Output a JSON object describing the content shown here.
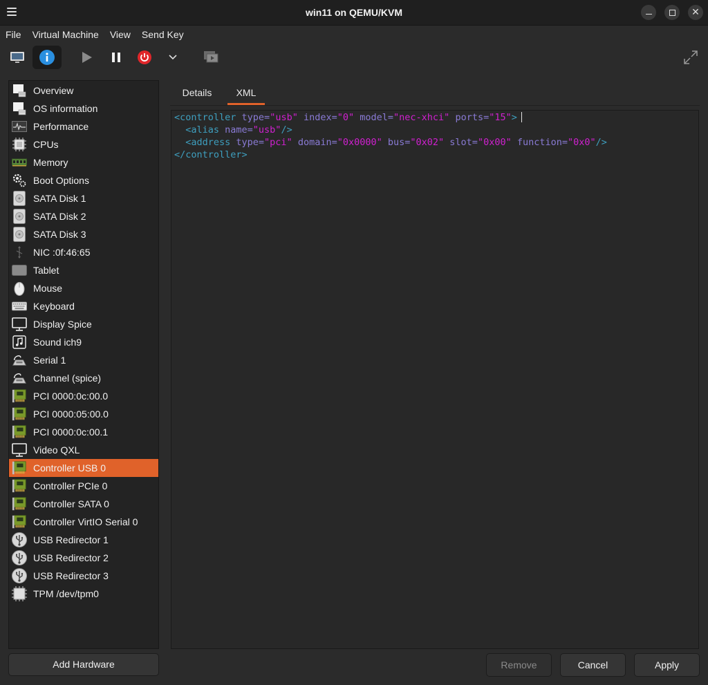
{
  "window": {
    "title": "win11 on QEMU/KVM"
  },
  "menubar": {
    "items": [
      "File",
      "Virtual Machine",
      "View",
      "Send Key"
    ]
  },
  "toolbar": {
    "buttons": [
      {
        "icon": "monitor-icon",
        "label": "Console"
      },
      {
        "icon": "info-icon",
        "label": "Details",
        "active": true
      },
      {
        "icon": "play-icon",
        "label": "Run"
      },
      {
        "icon": "pause-icon",
        "label": "Pause"
      },
      {
        "icon": "power-icon",
        "label": "Shut Down"
      },
      {
        "icon": "chevron-down-icon",
        "label": "Shutdown options"
      },
      {
        "icon": "snapshots-icon",
        "label": "Snapshots"
      },
      {
        "icon": "fullscreen-icon",
        "label": "Fullscreen"
      }
    ],
    "colors": {
      "power": "#e0262a",
      "info": "#2a8fe0"
    }
  },
  "sidebar": {
    "items": [
      {
        "label": "Overview",
        "icon": "overview-icon"
      },
      {
        "label": "OS information",
        "icon": "os-info-icon"
      },
      {
        "label": "Performance",
        "icon": "performance-icon"
      },
      {
        "label": "CPUs",
        "icon": "cpu-icon"
      },
      {
        "label": "Memory",
        "icon": "memory-icon"
      },
      {
        "label": "Boot Options",
        "icon": "boot-gear-icon"
      },
      {
        "label": "SATA Disk 1",
        "icon": "disk-icon"
      },
      {
        "label": "SATA Disk 2",
        "icon": "disk-icon"
      },
      {
        "label": "SATA Disk 3",
        "icon": "disk-icon"
      },
      {
        "label": "NIC :0f:46:65",
        "icon": "nic-icon"
      },
      {
        "label": "Tablet",
        "icon": "tablet-icon"
      },
      {
        "label": "Mouse",
        "icon": "mouse-icon"
      },
      {
        "label": "Keyboard",
        "icon": "keyboard-icon"
      },
      {
        "label": "Display Spice",
        "icon": "display-icon"
      },
      {
        "label": "Sound ich9",
        "icon": "sound-icon"
      },
      {
        "label": "Serial 1",
        "icon": "serial-icon"
      },
      {
        "label": "Channel (spice)",
        "icon": "serial-icon"
      },
      {
        "label": "PCI 0000:0c:00.0",
        "icon": "pci-card-icon"
      },
      {
        "label": "PCI 0000:05:00.0",
        "icon": "pci-card-icon"
      },
      {
        "label": "PCI 0000:0c:00.1",
        "icon": "pci-card-icon"
      },
      {
        "label": "Video QXL",
        "icon": "display-icon"
      },
      {
        "label": "Controller USB 0",
        "icon": "pci-card-icon",
        "selected": true
      },
      {
        "label": "Controller PCIe 0",
        "icon": "pci-card-icon"
      },
      {
        "label": "Controller SATA 0",
        "icon": "pci-card-icon"
      },
      {
        "label": "Controller VirtIO Serial 0",
        "icon": "pci-card-icon"
      },
      {
        "label": "USB Redirector 1",
        "icon": "usb-icon"
      },
      {
        "label": "USB Redirector 2",
        "icon": "usb-icon"
      },
      {
        "label": "USB Redirector 3",
        "icon": "usb-icon"
      },
      {
        "label": "TPM /dev/tpm0",
        "icon": "chip-icon"
      }
    ],
    "selected_color": "#e0622a",
    "add_hardware_label": "Add Hardware"
  },
  "tabs": {
    "items": [
      {
        "label": "Details"
      },
      {
        "label": "XML",
        "active": true
      }
    ]
  },
  "xml_editor": {
    "lines": [
      [
        [
          "t",
          "<controller "
        ],
        [
          "a",
          "type="
        ],
        [
          "v",
          "\"usb\""
        ],
        [
          "a",
          " index="
        ],
        [
          "v",
          "\"0\""
        ],
        [
          "a",
          " model="
        ],
        [
          "v",
          "\"nec-xhci\""
        ],
        [
          "a",
          " ports="
        ],
        [
          "v",
          "\"15\""
        ],
        [
          "t",
          ">"
        ]
      ],
      [
        [
          "t",
          "  <alias "
        ],
        [
          "a",
          "name="
        ],
        [
          "v",
          "\"usb\""
        ],
        [
          "t",
          "/>"
        ]
      ],
      [
        [
          "t",
          "  <address "
        ],
        [
          "a",
          "type="
        ],
        [
          "v",
          "\"pci\""
        ],
        [
          "a",
          " domain="
        ],
        [
          "v",
          "\"0x0000\""
        ],
        [
          "a",
          " bus="
        ],
        [
          "v",
          "\"0x02\""
        ],
        [
          "a",
          " slot="
        ],
        [
          "v",
          "\"0x00\""
        ],
        [
          "a",
          " function="
        ],
        [
          "v",
          "\"0x0\""
        ],
        [
          "t",
          "/>"
        ]
      ],
      [
        [
          "t",
          "</controller>"
        ]
      ]
    ],
    "colors": {
      "tag": "#3e9fbf",
      "attr": "#8a7bd6",
      "value": "#d020d0"
    }
  },
  "actions": {
    "remove_label": "Remove",
    "cancel_label": "Cancel",
    "apply_label": "Apply"
  }
}
